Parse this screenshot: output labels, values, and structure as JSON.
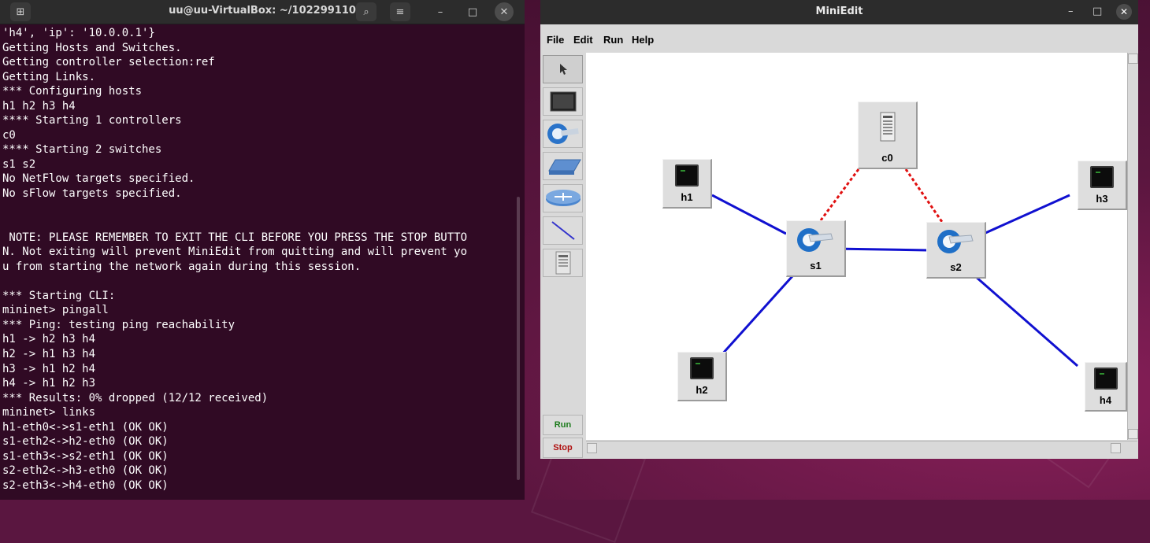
{
  "terminal": {
    "title": "uu@uu-VirtualBox: ~/102299110",
    "lines": [
      "'h4', 'ip': '10.0.0.1'}",
      "Getting Hosts and Switches.",
      "Getting controller selection:ref",
      "Getting Links.",
      "*** Configuring hosts",
      "h1 h2 h3 h4",
      "**** Starting 1 controllers",
      "c0",
      "**** Starting 2 switches",
      "s1 s2",
      "No NetFlow targets specified.",
      "No sFlow targets specified.",
      "",
      "",
      " NOTE: PLEASE REMEMBER TO EXIT THE CLI BEFORE YOU PRESS THE STOP BUTTO",
      "N. Not exiting will prevent MiniEdit from quitting and will prevent yo",
      "u from starting the network again during this session.",
      "",
      "*** Starting CLI:",
      "mininet> pingall",
      "*** Ping: testing ping reachability",
      "h1 -> h2 h3 h4",
      "h2 -> h1 h3 h4",
      "h3 -> h1 h2 h4",
      "h4 -> h1 h2 h3",
      "*** Results: 0% dropped (12/12 received)",
      "mininet> links",
      "h1-eth0<->s1-eth1 (OK OK)",
      "s1-eth2<->h2-eth0 (OK OK)",
      "s1-eth3<->s2-eth1 (OK OK)",
      "s2-eth2<->h3-eth0 (OK OK)",
      "s2-eth3<->h4-eth0 (OK OK)"
    ]
  },
  "miniedit": {
    "title": "MiniEdit",
    "menu": [
      "File",
      "Edit",
      "Run",
      "Help"
    ],
    "tools": [
      "select-tool",
      "host-tool",
      "switch-tool",
      "legacy-switch-tool",
      "legacy-router-tool",
      "netlink-tool",
      "controller-tool"
    ],
    "run_label": "Run",
    "stop_label": "Stop",
    "run_color": "#1a7a1a",
    "stop_color": "#b01010",
    "link_color": "#1010d0",
    "controller_link_color": "#e01010",
    "nodes": [
      {
        "id": "h1",
        "label": "h1",
        "type": "host"
      },
      {
        "id": "h2",
        "label": "h2",
        "type": "host"
      },
      {
        "id": "h3",
        "label": "h3",
        "type": "host"
      },
      {
        "id": "h4",
        "label": "h4",
        "type": "host"
      },
      {
        "id": "s1",
        "label": "s1",
        "type": "switch"
      },
      {
        "id": "s2",
        "label": "s2",
        "type": "switch"
      },
      {
        "id": "c0",
        "label": "c0",
        "type": "controller"
      }
    ],
    "links": [
      {
        "from": "h1",
        "to": "s1",
        "kind": "data"
      },
      {
        "from": "s1",
        "to": "h2",
        "kind": "data"
      },
      {
        "from": "s1",
        "to": "s2",
        "kind": "data"
      },
      {
        "from": "s2",
        "to": "h3",
        "kind": "data"
      },
      {
        "from": "s2",
        "to": "h4",
        "kind": "data"
      },
      {
        "from": "c0",
        "to": "s1",
        "kind": "control"
      },
      {
        "from": "c0",
        "to": "s2",
        "kind": "control"
      }
    ]
  }
}
